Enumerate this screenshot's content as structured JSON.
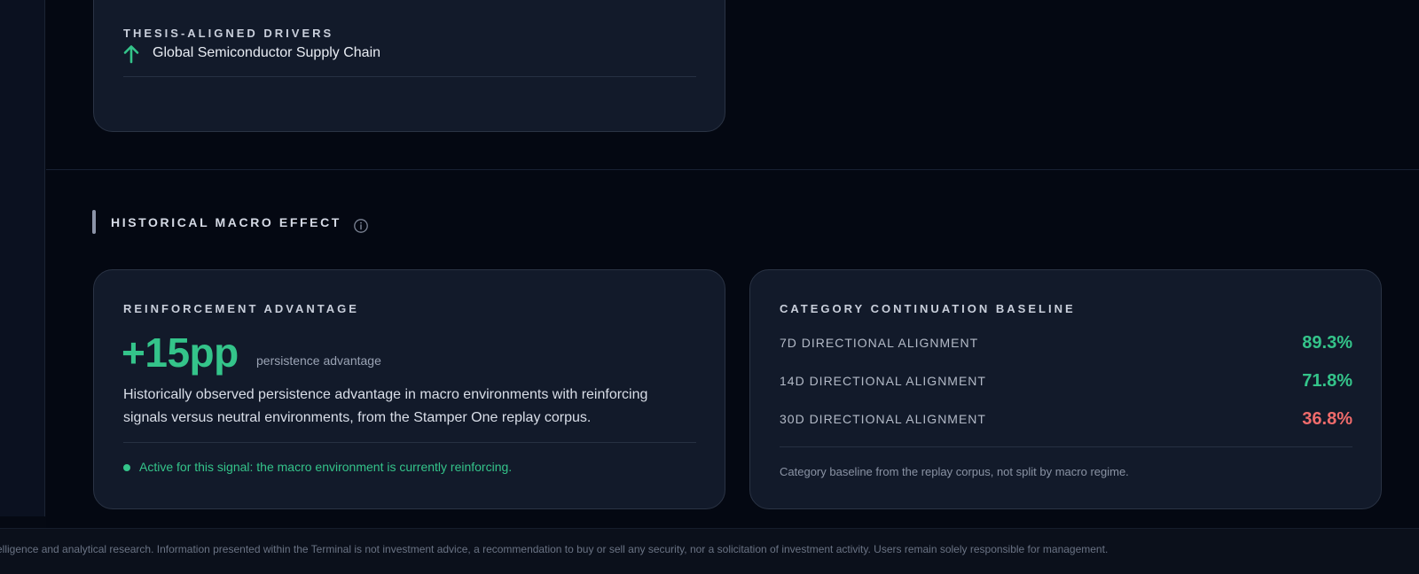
{
  "thesis_drivers": {
    "label": "THESIS-ALIGNED DRIVERS",
    "items": [
      {
        "icon": "arrow-up-icon",
        "name": "Global Semiconductor Supply Chain"
      }
    ]
  },
  "section": {
    "title": "HISTORICAL MACRO EFFECT",
    "info_icon": "info-icon"
  },
  "reinforcement": {
    "label": "REINFORCEMENT ADVANTAGE",
    "value": "+15pp",
    "value_sub": "persistence advantage",
    "description": "Historically observed persistence advantage in macro environments with reinforcing signals versus neutral environments, from the Stamper One replay corpus.",
    "status": "Active for this signal: the macro environment is currently reinforcing."
  },
  "baseline": {
    "label": "CATEGORY CONTINUATION BASELINE",
    "metrics": [
      {
        "name": "7D DIRECTIONAL ALIGNMENT",
        "value": "89.3%",
        "color": "#34c48a"
      },
      {
        "name": "14D DIRECTIONAL ALIGNMENT",
        "value": "71.8%",
        "color": "#34c48a"
      },
      {
        "name": "30D DIRECTIONAL ALIGNMENT",
        "value": "36.8%",
        "color": "#ef6b6b"
      }
    ],
    "note": "Category baseline from the replay corpus, not split by macro regime."
  },
  "footer": {
    "disclaimer": "elligence and analytical research. Information presented within the Terminal is not investment advice, a recommendation to buy or sell any security, nor a solicitation of investment activity. Users remain solely responsible for management."
  },
  "colors": {
    "positive": "#34c48a",
    "negative": "#ef6b6b",
    "card_bg": "#121a2a",
    "page_bg": "#040812"
  }
}
